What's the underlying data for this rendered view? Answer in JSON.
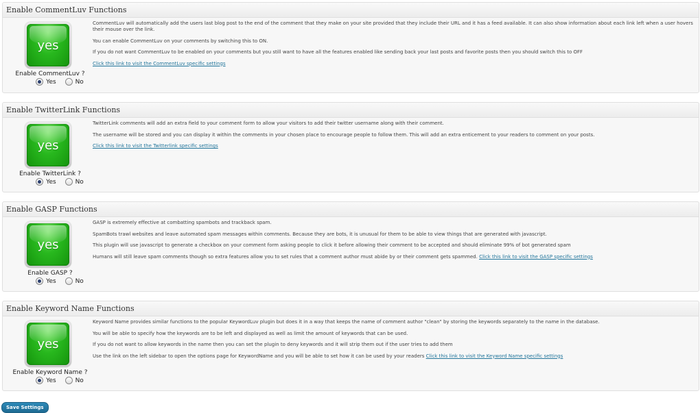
{
  "sections": [
    {
      "title": "Enable CommentLuv Functions",
      "icon_text": "yes",
      "toggle_label": "Enable CommentLuv ?",
      "yes_label": "Yes",
      "no_label": "No",
      "selected": "yes",
      "paragraphs": [
        "CommentLuv will automatically add the users last blog post to the end of the comment that they make on your site provided that they include their URL and it has a feed available. It can also show information about each link left when a user hovers their mouse over the link.",
        "You can enable CommentLuv on your comments by switching this to ON.",
        "If you do not want CommentLuv to be enabled on your comments but you still want to have all the features enabled like sending back your last posts and favorite posts then you should switch this to OFF"
      ],
      "link_text": "Click this link to visit the CommentLuv specific settings",
      "link_inline": false
    },
    {
      "title": "Enable TwitterLink Functions",
      "icon_text": "yes",
      "toggle_label": "Enable TwitterLink ?",
      "yes_label": "Yes",
      "no_label": "No",
      "selected": "yes",
      "paragraphs": [
        "TwitterLink comments will add an extra field to your comment form to allow your visitors to add their twitter username along with their comment.",
        "The username will be stored and you can display it within the comments in your chosen place to encourage people to follow them. This will add an extra enticement to your readers to comment on your posts."
      ],
      "link_text": "Click this link to visit the Twitterlink specific settings",
      "link_inline": false
    },
    {
      "title": "Enable GASP Functions",
      "icon_text": "yes",
      "toggle_label": "Enable GASP ?",
      "yes_label": "Yes",
      "no_label": "No",
      "selected": "yes",
      "paragraphs": [
        "GASP is extremely effective at combatting spambots and trackback spam.",
        "SpamBots trawl websites and leave automated spam messages within comments. Because they are bots, it is unusual for them to be able to view things that are generated with javascript.",
        "This plugin will use javascript to generate a checkbox on your comment form asking people to click it before allowing their comment to be accepted and should eliminate 99% of bot generated spam",
        "Humans will still leave spam comments though so extra features allow you to set rules that a comment author must abide by or their comment gets spammed."
      ],
      "link_text": "Click this link to visit the GASP specific settings",
      "link_inline": true
    },
    {
      "title": "Enable Keyword Name Functions",
      "icon_text": "yes",
      "toggle_label": "Enable Keyword Name ?",
      "yes_label": "Yes",
      "no_label": "No",
      "selected": "yes",
      "paragraphs": [
        "Keyword Name provides similar functions to the popular KeywordLuv plugin but does it in a way that keeps the name of comment author \"clean\" by storing the keywords separately to the name in the database.",
        "You will be able to specify how the keywords are to be left and displayed as well as limit the amount of keywords that can be used.",
        "If you do not want to allow keywords in the name then you can set the plugin to deny keywords and it will strip them out if the user tries to add them",
        "Use the link on the left sidebar to open the options page for KeywordName and you will be able to set how it can be used by your readers"
      ],
      "link_text": "Click this link to visit the Keyword Name specific settings",
      "link_inline": true
    }
  ],
  "save_button": "Save Settings"
}
